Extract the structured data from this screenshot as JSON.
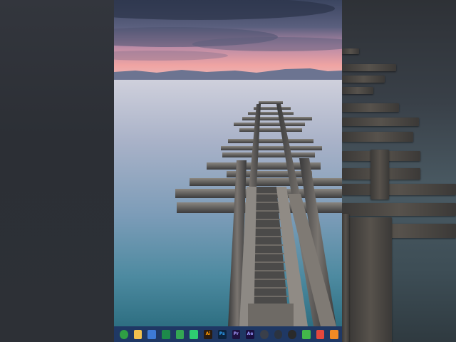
{
  "taskbar": {
    "icons": [
      {
        "name": "chrome-icon",
        "glyph": "",
        "bg": "#2f9e44",
        "fg": "#ffffff",
        "round": true
      },
      {
        "name": "file-explorer-icon",
        "glyph": "",
        "bg": "#f2c14e",
        "fg": "#ffffff",
        "round": false
      },
      {
        "name": "store-icon",
        "glyph": "",
        "bg": "#3d7ad6",
        "fg": "#ffffff",
        "round": false
      },
      {
        "name": "excel-icon",
        "glyph": "",
        "bg": "#1d8a4a",
        "fg": "#ffffff",
        "round": false
      },
      {
        "name": "sheets-icon",
        "glyph": "",
        "bg": "#34a853",
        "fg": "#ffffff",
        "round": false
      },
      {
        "name": "phone-icon",
        "glyph": "",
        "bg": "#2ecc71",
        "fg": "#ffffff",
        "round": false
      },
      {
        "name": "illustrator-icon",
        "glyph": "Ai",
        "bg": "#2b1c10",
        "fg": "#ff9a00",
        "round": false
      },
      {
        "name": "photoshop-icon",
        "glyph": "Ps",
        "bg": "#0c2440",
        "fg": "#31a8ff",
        "round": false
      },
      {
        "name": "premiere-icon",
        "glyph": "Pr",
        "bg": "#1f1240",
        "fg": "#a99cff",
        "round": false
      },
      {
        "name": "after-effects-icon",
        "glyph": "Ae",
        "bg": "#1a1040",
        "fg": "#9999ff",
        "round": false
      },
      {
        "name": "davinci-icon",
        "glyph": "",
        "bg": "#3a3f4a",
        "fg": "#ffffff",
        "round": true
      },
      {
        "name": "davinci-alt-icon",
        "glyph": "",
        "bg": "#2b3340",
        "fg": "#ffffff",
        "round": true
      },
      {
        "name": "obs-icon",
        "glyph": "",
        "bg": "#2a2a2a",
        "fg": "#ffffff",
        "round": true
      },
      {
        "name": "green-app-icon",
        "glyph": "",
        "bg": "#43b74a",
        "fg": "#ffffff",
        "round": false
      },
      {
        "name": "red-app-icon",
        "glyph": "",
        "bg": "#e5483d",
        "fg": "#ffffff",
        "round": false
      },
      {
        "name": "orange-app-icon",
        "glyph": "",
        "bg": "#f08a24",
        "fg": "#ffffff",
        "round": false
      }
    ]
  },
  "colors": {
    "sky_top": "#4b5470",
    "sky_pink": "#e8a0a5",
    "mountains": "#6c7491",
    "water_top": "#c9cbd8",
    "water_bottom": "#2c6f83",
    "taskbar": "#1f3864"
  }
}
